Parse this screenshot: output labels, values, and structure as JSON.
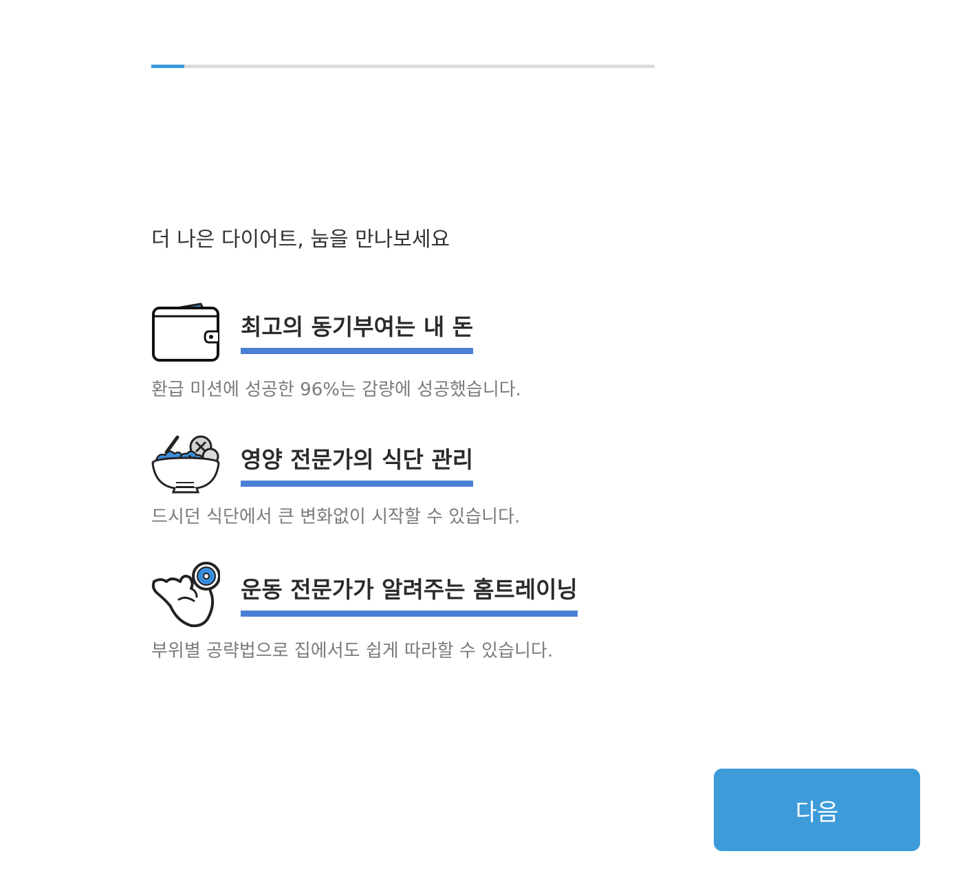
{
  "progress": {
    "fraction": 0.066
  },
  "intro": {
    "text": "더 나은 다이어트, 눔을 만나보세요"
  },
  "features": [
    {
      "icon": "wallet-icon",
      "title": "최고의 동기부여는 내 돈",
      "description": "환급 미션에 성공한 96%는 감량에 성공했습니다."
    },
    {
      "icon": "salad-bowl-icon",
      "title": "영양 전문가의 식단 관리",
      "description": "드시던 식단에서 큰 변화없이 시작할 수 있습니다."
    },
    {
      "icon": "muscle-arm-icon",
      "title": "운동 전문가가 알려주는 홈트레이닝",
      "description": "부위별 공략법으로 집에서도 쉽게 따라할 수 있습니다."
    }
  ],
  "next_button": {
    "label": "다음"
  },
  "colors": {
    "accent": "#3a9ad9",
    "underline": "#4a7fd6",
    "icon_blue": "#3a8fdc",
    "button": "#3d9bda"
  }
}
